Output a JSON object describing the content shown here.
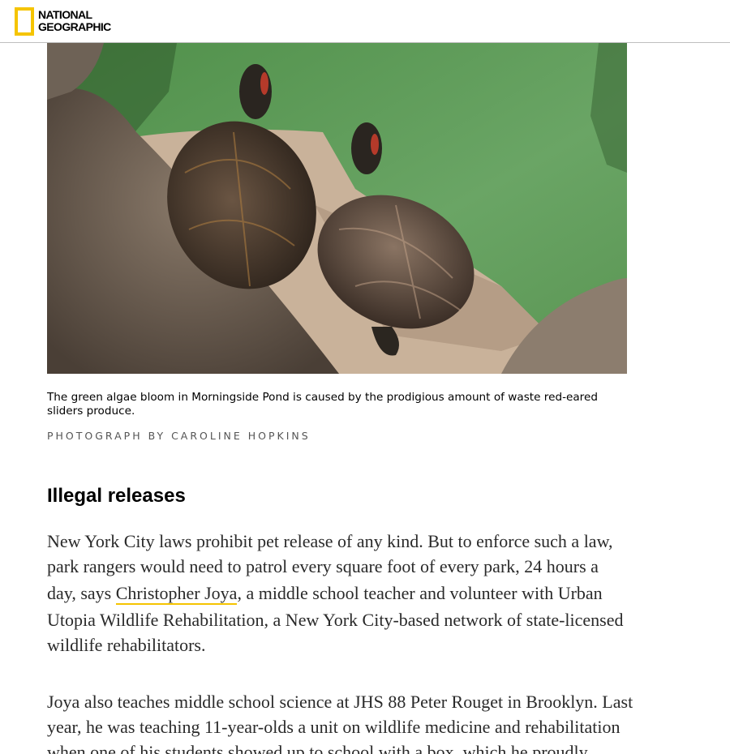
{
  "header": {
    "logo_line1": "NATIONAL",
    "logo_line2": "GEOGRAPHIC",
    "brand_color": "#f5c400"
  },
  "figure": {
    "caption_line1": "The green algae bloom in Morningside Pond is caused by the prodigious amount of waste red-eared",
    "caption_line2": "sliders produce.",
    "credit": "PHOTOGRAPH BY CAROLINE HOPKINS"
  },
  "article": {
    "heading": "Illegal releases",
    "p1": {
      "line1": "New York City laws prohibit pet release of any kind. But to enforce such a law,",
      "line2": "park rangers would need to patrol every square foot of every park, 24 hours a",
      "line3_before": "day, says ",
      "line3_link": "Christopher Joya",
      "line3_after": ", a middle school teacher and volunteer with Urban",
      "line4": "Utopia Wildlife Rehabilitation, a New York City-based network of state-licensed",
      "line5": "wildlife rehabilitators."
    },
    "p2": {
      "line1": "Joya also teaches middle school science at JHS 88 Peter Rouget in Brooklyn. Last",
      "line2": "year, he was teaching 11-year-olds a unit on wildlife medicine and rehabilitation",
      "line3": "when one of his students showed up to school with a box, which he proudly"
    }
  }
}
